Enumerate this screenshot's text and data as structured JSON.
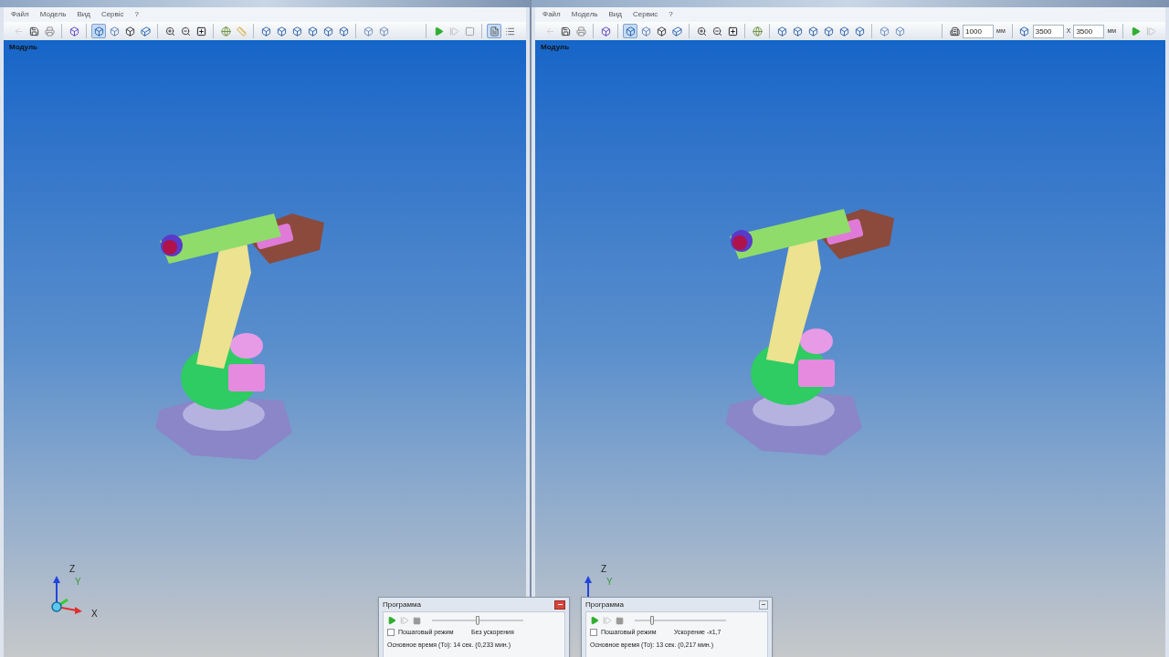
{
  "panes": [
    {
      "menu": [
        "Файл",
        "Модель",
        "Вид",
        "Сервіс",
        "?"
      ],
      "toolbar": [
        {
          "kind": "back",
          "selected": false
        },
        {
          "kind": "save",
          "selected": false
        },
        {
          "kind": "print",
          "selected": false
        },
        {
          "kind": "sep"
        },
        {
          "kind": "model",
          "selected": false
        },
        {
          "kind": "sep"
        },
        {
          "kind": "cube-shaded",
          "selected": true
        },
        {
          "kind": "cube-wire",
          "selected": false
        },
        {
          "kind": "cube-outline",
          "selected": false
        },
        {
          "kind": "cube-solid",
          "selected": false
        },
        {
          "kind": "sep"
        },
        {
          "kind": "zoom-in",
          "selected": false
        },
        {
          "kind": "zoom-out",
          "selected": false
        },
        {
          "kind": "zoom-fit",
          "selected": false
        },
        {
          "kind": "sep"
        },
        {
          "kind": "color",
          "selected": false
        },
        {
          "kind": "measure",
          "selected": false
        },
        {
          "kind": "sep"
        },
        {
          "kind": "cube-view",
          "selected": false
        },
        {
          "kind": "cube-view",
          "selected": false
        },
        {
          "kind": "cube-view",
          "selected": false
        },
        {
          "kind": "cube-view",
          "selected": false
        },
        {
          "kind": "cube-view",
          "selected": false
        },
        {
          "kind": "cube-view",
          "selected": false
        },
        {
          "kind": "sep"
        },
        {
          "kind": "cube-light",
          "selected": false
        },
        {
          "kind": "cube-light",
          "selected": false
        },
        {
          "kind": "gap"
        },
        {
          "kind": "sep"
        },
        {
          "kind": "play",
          "selected": false
        },
        {
          "kind": "step",
          "selected": false
        },
        {
          "kind": "stop",
          "selected": false
        },
        {
          "kind": "sep"
        },
        {
          "kind": "document",
          "selected": true
        },
        {
          "kind": "list",
          "selected": false
        }
      ],
      "viewport_label": "Модуль",
      "axes": [
        "Z",
        "Y",
        "X"
      ],
      "program": {
        "title": "Программа",
        "active": true,
        "step_mode": {
          "label": "Пошаговый режим",
          "checked": false
        },
        "speed": "Без ускорения",
        "time": "Основное время (То): 14 сек. (0,233 мин.)",
        "level": 0.5
      }
    },
    {
      "menu": [
        "Файл",
        "Модель",
        "Вид",
        "Сервис",
        "?"
      ],
      "toolbar": [
        {
          "kind": "back",
          "selected": false
        },
        {
          "kind": "save",
          "selected": false
        },
        {
          "kind": "print",
          "selected": false
        },
        {
          "kind": "sep"
        },
        {
          "kind": "model",
          "selected": false
        },
        {
          "kind": "sep"
        },
        {
          "kind": "cube-shaded",
          "selected": true
        },
        {
          "kind": "cube-wire",
          "selected": false
        },
        {
          "kind": "cube-outline",
          "selected": false
        },
        {
          "kind": "cube-solid",
          "selected": false
        },
        {
          "kind": "sep"
        },
        {
          "kind": "zoom-in",
          "selected": false
        },
        {
          "kind": "zoom-out",
          "selected": false
        },
        {
          "kind": "zoom-fit",
          "selected": false
        },
        {
          "kind": "sep"
        },
        {
          "kind": "color",
          "selected": false
        },
        {
          "kind": "sep"
        },
        {
          "kind": "cube-view",
          "selected": false
        },
        {
          "kind": "cube-view",
          "selected": false
        },
        {
          "kind": "cube-view",
          "selected": false
        },
        {
          "kind": "cube-view",
          "selected": false
        },
        {
          "kind": "cube-view",
          "selected": false
        },
        {
          "kind": "cube-view",
          "selected": false
        },
        {
          "kind": "sep"
        },
        {
          "kind": "cube-light",
          "selected": false
        },
        {
          "kind": "cube-light",
          "selected": false
        },
        {
          "kind": "gap"
        },
        {
          "kind": "sep"
        },
        {
          "kind": "height",
          "selected": false
        },
        {
          "kind": "input",
          "value": "1000"
        },
        {
          "kind": "unit",
          "value": "мм"
        },
        {
          "kind": "sep"
        },
        {
          "kind": "area",
          "selected": false
        },
        {
          "kind": "input",
          "value": "3500"
        },
        {
          "kind": "unit",
          "value": "X"
        },
        {
          "kind": "input",
          "value": "3500"
        },
        {
          "kind": "unit",
          "value": "мм"
        },
        {
          "kind": "sep"
        },
        {
          "kind": "play",
          "selected": false
        },
        {
          "kind": "step",
          "selected": false
        }
      ],
      "viewport_label": "Модуль",
      "axes": [
        "Z",
        "Y"
      ],
      "program": {
        "title": "Программа",
        "active": false,
        "step_mode": {
          "label": "Пошаговый режим",
          "checked": false
        },
        "speed": "Ускорение -x1,7",
        "time": "Основное время (То): 13 сек. (0,217 мин.)",
        "level": 0.18
      }
    }
  ]
}
